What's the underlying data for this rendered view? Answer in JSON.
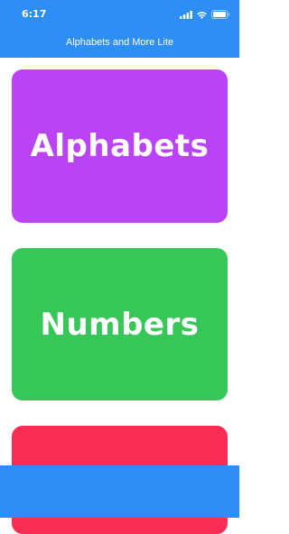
{
  "status_bar": {
    "time": "6:17",
    "icons": [
      "cellular-signal-icon",
      "wifi-icon",
      "battery-icon"
    ]
  },
  "nav": {
    "title": "Alphabets and More Lite"
  },
  "cards": [
    {
      "label": "Alphabets",
      "color": "#bb43f7"
    },
    {
      "label": "Numbers",
      "color": "#37c759"
    },
    {
      "label": "",
      "color": "#fb2d55"
    }
  ],
  "colors": {
    "primary": "#2d8ef6",
    "background": "#ffffff"
  }
}
